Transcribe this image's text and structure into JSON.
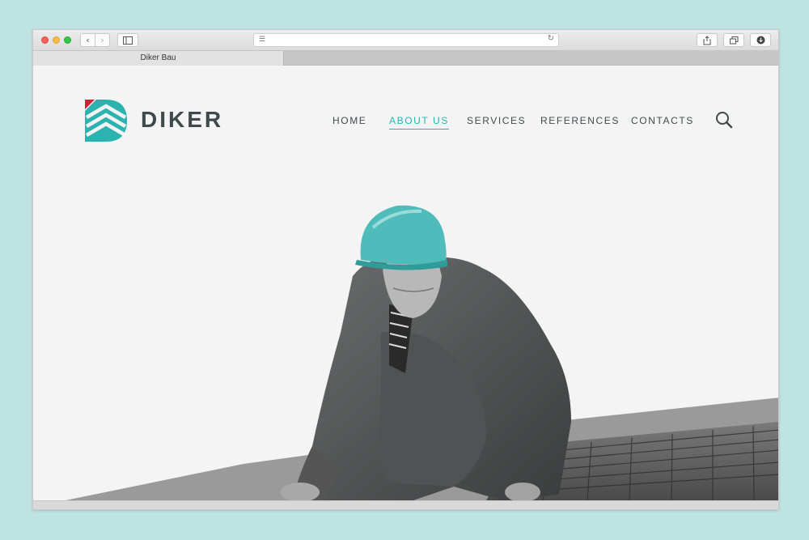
{
  "browser": {
    "tab_title": "Diker Bau",
    "address_text": "",
    "icons": [
      "close-icon",
      "minimize-icon",
      "maximize-icon",
      "chevron-left-icon",
      "chevron-right-icon",
      "sidebar-icon",
      "menu-lines-icon",
      "reload-icon",
      "share-icon",
      "tabs-icon",
      "download-icon"
    ]
  },
  "site": {
    "brand": "DIKER",
    "nav": [
      {
        "label": "HOME",
        "active": false
      },
      {
        "label": "ABOUT US",
        "active": true
      },
      {
        "label": "SERVICES",
        "active": false
      },
      {
        "label": "REFERENCES",
        "active": false
      },
      {
        "label": "CONTACTS",
        "active": false
      }
    ],
    "colors": {
      "accent": "#2bb3b0",
      "logo_red": "#d81e30",
      "text": "#3e4a4b",
      "background": "#f4f4f4"
    }
  }
}
